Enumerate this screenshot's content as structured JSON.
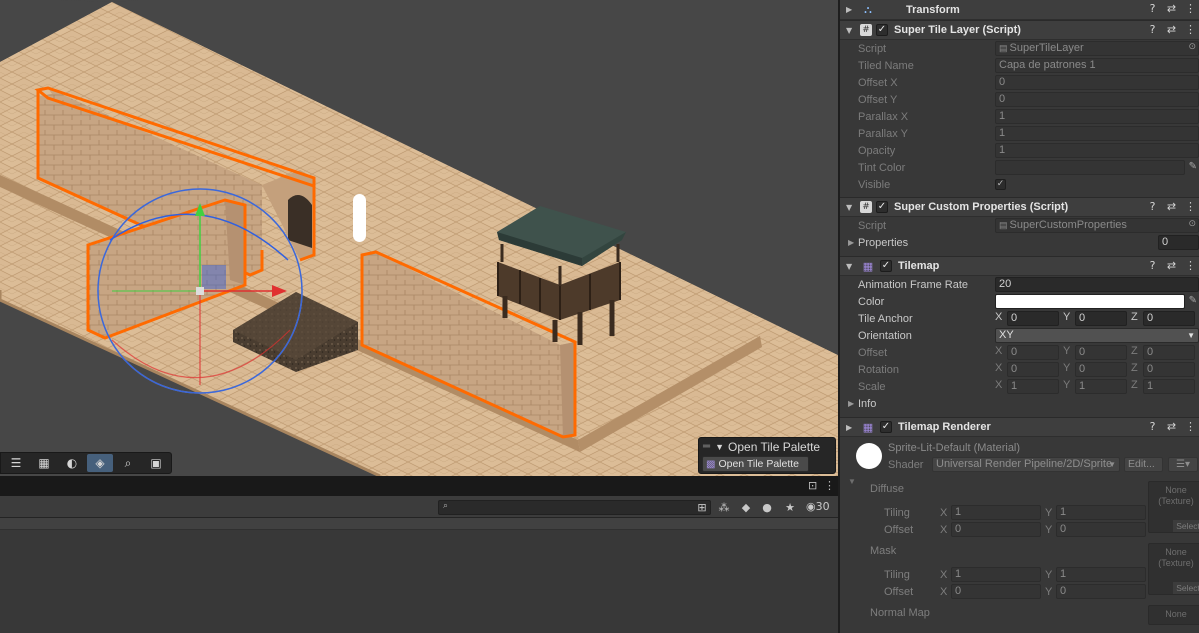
{
  "scene_overlay": {
    "title": "Open Tile Palette",
    "button_label": "Open Tile Palette"
  },
  "bottom_panel": {
    "search_placeholder": "",
    "visible_count": "30"
  },
  "inspector": {
    "transform": {
      "title": "Transform"
    },
    "super_tile_layer": {
      "title": "Super Tile Layer (Script)",
      "rows": [
        {
          "label": "Script",
          "value": "SuperTileLayer"
        },
        {
          "label": "Tiled Name",
          "value": "Capa de patrones 1"
        },
        {
          "label": "Offset X",
          "value": "0"
        },
        {
          "label": "Offset Y",
          "value": "0"
        },
        {
          "label": "Parallax X",
          "value": "1"
        },
        {
          "label": "Parallax Y",
          "value": "1"
        },
        {
          "label": "Opacity",
          "value": "1"
        },
        {
          "label": "Tint Color",
          "value": "#ffffff"
        },
        {
          "label": "Visible",
          "value": "true"
        }
      ]
    },
    "super_custom_properties": {
      "title": "Super Custom Properties (Script)",
      "script_label": "Script",
      "script_value": "SuperCustomProperties",
      "properties_label": "Properties",
      "properties_count": "0"
    },
    "tilemap": {
      "title": "Tilemap",
      "animation_frame_rate_label": "Animation Frame Rate",
      "animation_frame_rate": "20",
      "color_label": "Color",
      "color_value": "#ffffff",
      "tile_anchor_label": "Tile Anchor",
      "tile_anchor": {
        "x": "0",
        "y": "0",
        "z": "0"
      },
      "orientation_label": "Orientation",
      "orientation": "XY",
      "offset_label": "Offset",
      "offset": {
        "x": "0",
        "y": "0",
        "z": "0"
      },
      "rotation_label": "Rotation",
      "rotation": {
        "x": "0",
        "y": "0",
        "z": "0"
      },
      "scale_label": "Scale",
      "scale": {
        "x": "1",
        "y": "1",
        "z": "1"
      },
      "info_label": "Info"
    },
    "tilemap_renderer": {
      "title": "Tilemap Renderer"
    },
    "material": {
      "name": "Sprite-Lit-Default (Material)",
      "shader_label": "Shader",
      "shader_value": "Universal Render Pipeline/2D/Sprite",
      "edit_label": "Edit...",
      "diffuse_label": "Diffuse",
      "tiling_label": "Tiling",
      "offset_label": "Offset",
      "diffuse_tiling": {
        "x": "1",
        "y": "1"
      },
      "diffuse_offset": {
        "x": "0",
        "y": "0"
      },
      "mask_label": "Mask",
      "mask_tiling": {
        "x": "1",
        "y": "1"
      },
      "mask_offset": {
        "x": "0",
        "y": "0"
      },
      "normal_map_label": "Normal Map",
      "texture_none": "None",
      "texture_type": "(Texture)",
      "select_label": "Select",
      "normal_none": "None"
    },
    "axis": {
      "x": "X",
      "y": "Y",
      "z": "Z"
    }
  },
  "colors": {
    "selection_outline": "#ff6a00",
    "gizmo_x": "#e03030",
    "gizmo_y": "#40d040",
    "gizmo_z": "#3060e0",
    "accent": "#46607c"
  }
}
